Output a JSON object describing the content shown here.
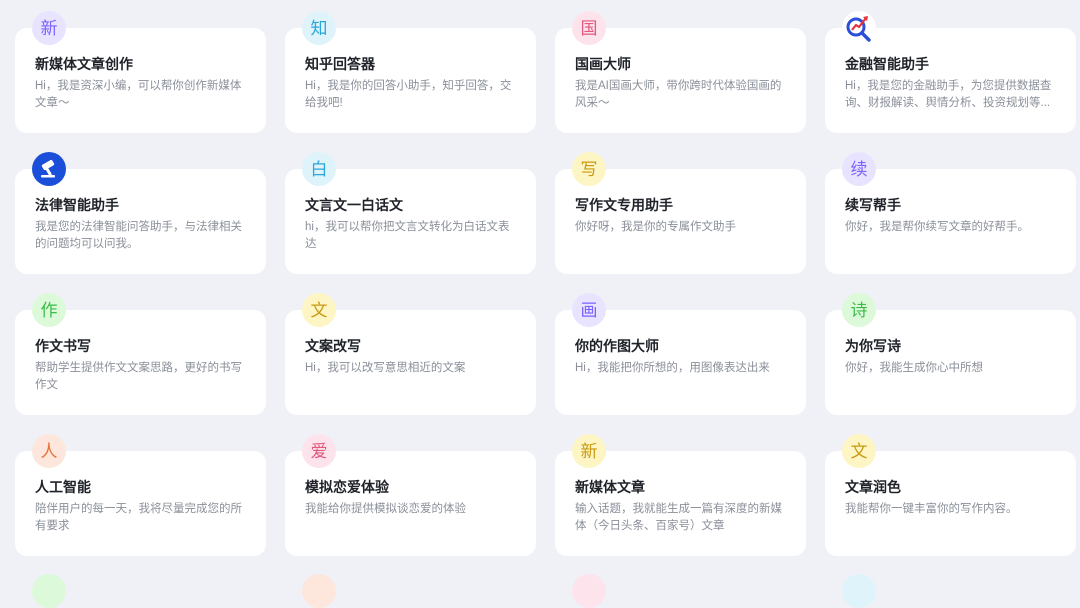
{
  "cards": [
    {
      "title": "新媒体文章创作",
      "desc": "Hi，我是资深小编，可以帮你创作新媒体文章～",
      "avatar_char": "新",
      "avatar_bg": "#e8e4ff",
      "avatar_color": "#7b61ff"
    },
    {
      "title": "知乎回答器",
      "desc": "Hi，我是你的回答小助手，知乎回答，交给我吧!",
      "avatar_char": "知",
      "avatar_bg": "#dff3fb",
      "avatar_color": "#2aa6d8"
    },
    {
      "title": "国画大师",
      "desc": "我是AI国画大师，带你跨时代体验国画的风采～",
      "avatar_char": "国",
      "avatar_bg": "#fde4ec",
      "avatar_color": "#e4577f"
    },
    {
      "title": "金融智能助手",
      "desc": "Hi，我是您的金融助手，为您提供数据查询、财报解读、舆情分析、投资规划等...",
      "avatar_icon": "finance-magnifier-logo"
    },
    {
      "title": "法律智能助手",
      "desc": "我是您的法律智能问答助手，与法律相关的问题均可以问我。",
      "avatar_icon": "law-gavel-logo"
    },
    {
      "title": "文言文一白话文",
      "desc": "hi，我可以帮你把文言文转化为白话文表达",
      "avatar_char": "白",
      "avatar_bg": "#dff3fb",
      "avatar_color": "#2aa6d8"
    },
    {
      "title": "写作文专用助手",
      "desc": "你好呀，我是你的专属作文助手",
      "avatar_char": "写",
      "avatar_bg": "#fdf5c4",
      "avatar_color": "#c99a12"
    },
    {
      "title": "续写帮手",
      "desc": "你好，我是帮你续写文章的好帮手。",
      "avatar_char": "续",
      "avatar_bg": "#e8e4ff",
      "avatar_color": "#7b61ff"
    },
    {
      "title": "作文书写",
      "desc": "帮助学生提供作文文案思路，更好的书写作文",
      "avatar_char": "作",
      "avatar_bg": "#dcfad9",
      "avatar_color": "#3dbb4a"
    },
    {
      "title": "文案改写",
      "desc": "Hi，我可以改写意思相近的文案",
      "avatar_char": "文",
      "avatar_bg": "#fdf5c4",
      "avatar_color": "#c99a12"
    },
    {
      "title": "你的作图大师",
      "desc": "Hi，我能把你所想的，用图像表达出来",
      "avatar_char": "画",
      "avatar_bg": "#e8e4ff",
      "avatar_color": "#7b61ff"
    },
    {
      "title": "为你写诗",
      "desc": "你好，我能生成你心中所想",
      "avatar_char": "诗",
      "avatar_bg": "#dcfad9",
      "avatar_color": "#3dbb4a"
    },
    {
      "title": "人工智能",
      "desc": "陪伴用户的每一天，我将尽量完成您的所有要求",
      "avatar_char": "人",
      "avatar_bg": "#fde7dc",
      "avatar_color": "#e6733a"
    },
    {
      "title": "模拟恋爱体验",
      "desc": "我能给你提供模拟谈恋爱的体验",
      "avatar_char": "爱",
      "avatar_bg": "#fde4ec",
      "avatar_color": "#e4577f"
    },
    {
      "title": "新媒体文章",
      "desc": "输入话题，我就能生成一篇有深度的新媒体（今日头条、百家号）文章",
      "avatar_char": "新",
      "avatar_bg": "#fdf5c4",
      "avatar_color": "#c99a12"
    },
    {
      "title": "文章润色",
      "desc": "我能帮你一键丰富你的写作内容。",
      "avatar_char": "文",
      "avatar_bg": "#fdf5c4",
      "avatar_color": "#c99a12"
    }
  ],
  "partial_avatar_colors": [
    "#dcfad9",
    "#fde7dc",
    "#fde4ec",
    "#dff3fb"
  ]
}
